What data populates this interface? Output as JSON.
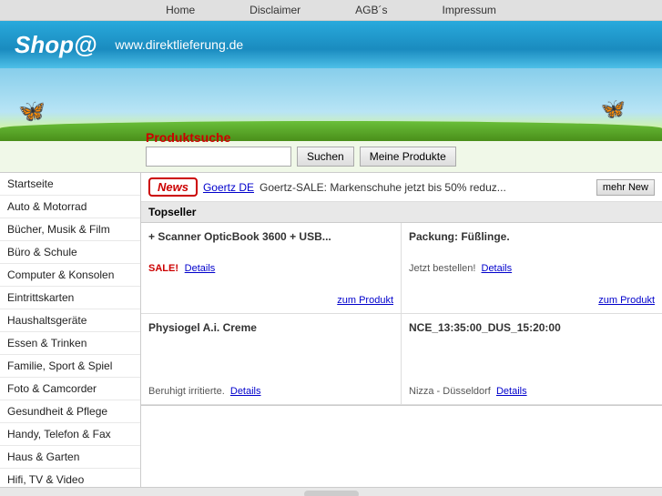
{
  "nav": {
    "items": [
      {
        "label": "Home",
        "id": "nav-home"
      },
      {
        "label": "Disclaimer",
        "id": "nav-disclaimer"
      },
      {
        "label": "AGB´s",
        "id": "nav-agbs"
      },
      {
        "label": "Impressum",
        "id": "nav-impressum"
      }
    ]
  },
  "header": {
    "logo": "Shop@",
    "url": "www.direktlieferung.de"
  },
  "search": {
    "label": "Produktsuche",
    "placeholder": "",
    "search_btn": "Suchen",
    "my_products_btn": "Meine Produkte"
  },
  "sidebar": {
    "items": [
      "Startseite",
      "Auto & Motorrad",
      "Bücher, Musik & Film",
      "Büro & Schule",
      "Computer & Konsolen",
      "Eintrittskarten",
      "Haushaltsgeräte",
      "Essen & Trinken",
      "Familie, Sport & Spiel",
      "Foto & Camcorder",
      "Gesundheit & Pflege",
      "Handy, Telefon & Fax",
      "Haus & Garten",
      "Hifi, TV & Video"
    ]
  },
  "news": {
    "badge": "News",
    "link_text": "Goertz DE",
    "text": "Goertz-SALE: Markenschuhe jetzt bis 50% reduz...",
    "mehr_btn": "mehr New"
  },
  "topseller": {
    "header": "Topseller",
    "products": [
      {
        "title": "+ Scanner OpticBook 3600 + USB...",
        "sale": "SALE!",
        "detail": "Details",
        "zum_produkt": "zum Produkt"
      },
      {
        "title": "Packung: Füßlinge.",
        "sub": "Jetzt bestellen!",
        "detail": "Details",
        "zum_produkt": "zum Produkt"
      },
      {
        "title": "Physiogel A.i. Creme",
        "sub": "Beruhigt irritierte.",
        "detail": "Details",
        "zum_produkt": ""
      },
      {
        "title": "NCE_13:35:00_DUS_15:20:00",
        "sub": "Nizza - Düsseldorf",
        "detail": "Details",
        "zum_produkt": ""
      }
    ]
  },
  "butterflies": {
    "left": "🦋",
    "right": "🦋"
  }
}
